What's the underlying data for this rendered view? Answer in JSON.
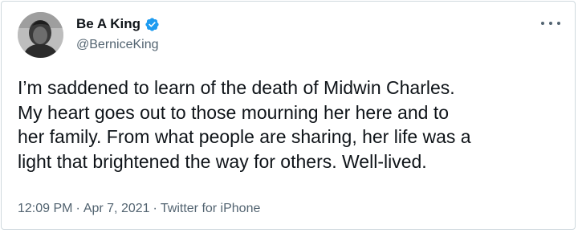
{
  "tweet": {
    "display_name": "Be A King",
    "handle": "@BerniceKing",
    "verified": true,
    "verified_icon": "verified-badge-icon",
    "more_icon": "more-options-icon",
    "avatar_icon": "profile-avatar",
    "text": "I’m saddened to learn of the death of Midwin Charles.\nMy heart goes out to those mourning her here and to\nher family. From what people are sharing, her life was a\nlight that brightened the way for others. Well-lived.",
    "time": "12:09 PM",
    "separator": "·",
    "date": "Apr 7, 2021",
    "source": "Twitter for iPhone"
  },
  "colors": {
    "text_primary": "#0f1419",
    "text_secondary": "#536471",
    "verified_blue": "#1d9bf0",
    "border": "#cfd9de"
  }
}
